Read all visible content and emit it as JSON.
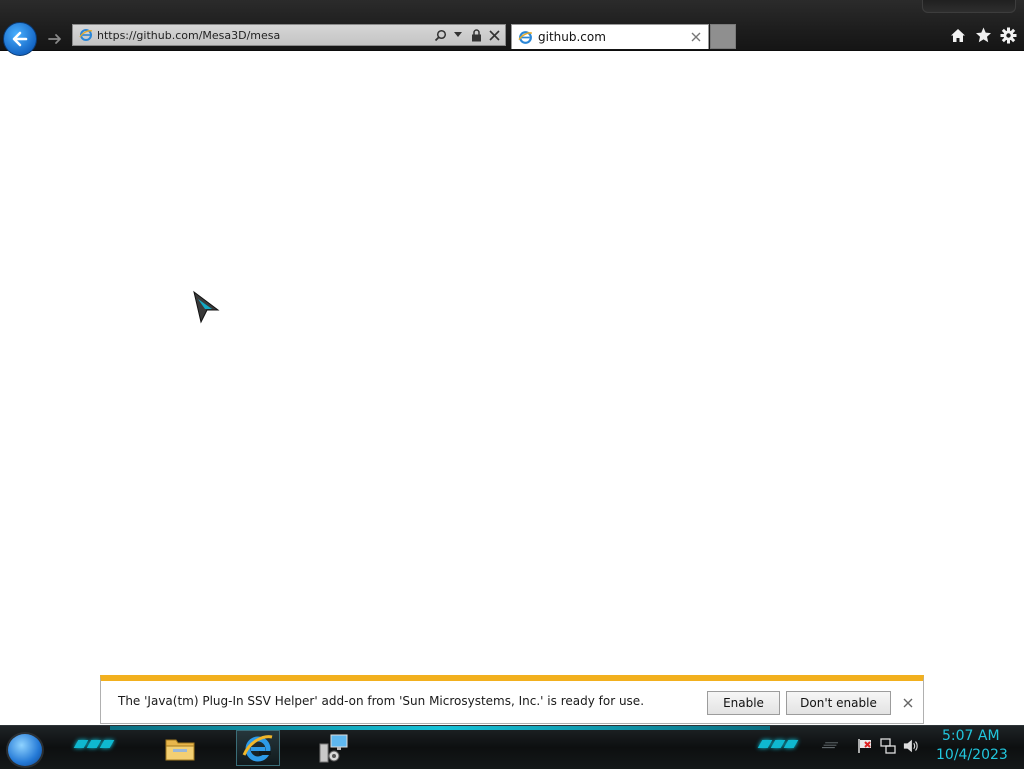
{
  "browser": {
    "address_url": "https://github.com/Mesa3D/mesa",
    "tab_title": "github.com"
  },
  "notification": {
    "message": "The 'Java(tm) Plug-In SSV Helper' add-on from 'Sun Microsystems, Inc.' is ready for use.",
    "enable_label": "Enable",
    "dont_enable_label": "Don't enable"
  },
  "taskbar": {
    "time": "5:07 AM",
    "date": "10/4/2023",
    "apps": [
      "file-explorer-icon",
      "internet-explorer-icon",
      "network-computer-icon"
    ]
  },
  "colors": {
    "notification_accent": "#f2b01e",
    "clock": "#21c6dd",
    "back_button": "#1567c6"
  }
}
